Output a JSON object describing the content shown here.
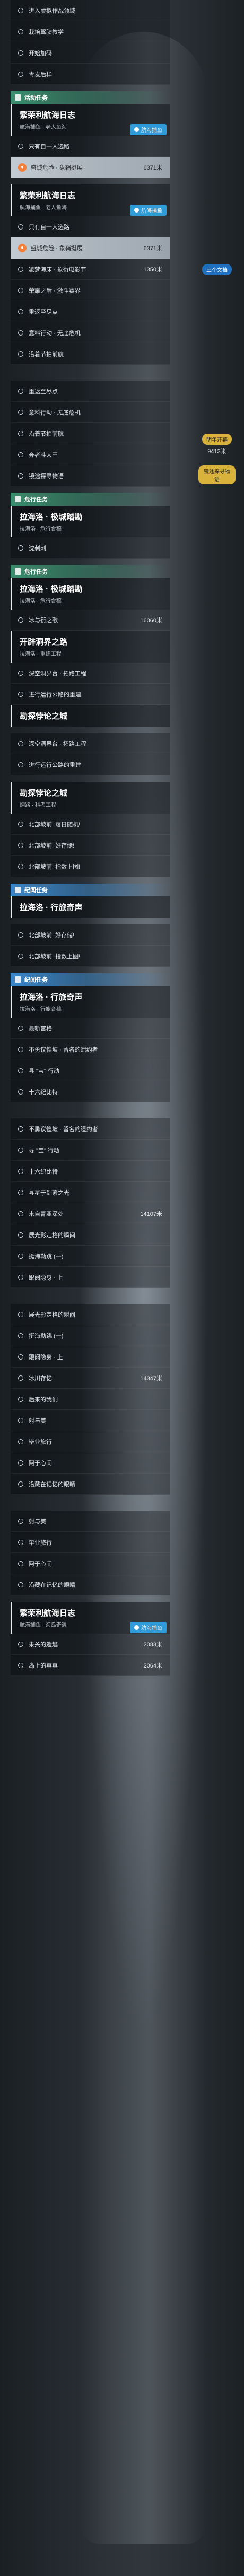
{
  "sec1": {
    "rows": [
      {
        "label": "进入虚拟作战领域!",
        "dist": ""
      },
      {
        "label": "栽培驾驶教学",
        "dist": ""
      },
      {
        "label": "开始加码",
        "dist": ""
      },
      {
        "label": "青发后样",
        "dist": ""
      }
    ]
  },
  "sec2": {
    "header": "活动任务",
    "card": {
      "title": "繁荣利航海日志",
      "sub": "航海捕鱼 · 老人鱼海",
      "badge": "航海捕鱼"
    },
    "rows": [
      {
        "label": "只有自一人选路",
        "dist": ""
      },
      {
        "label": "盛城危险 · 象鞘挺展",
        "dist": "6371米",
        "active": true
      }
    ]
  },
  "sec3": {
    "card": {
      "title": "繁荣利航海日志",
      "sub": "航海捕鱼 · 老人鱼海",
      "badge": "航海捕鱼"
    },
    "rows": [
      {
        "label": "只有自一人选路",
        "dist": ""
      },
      {
        "label": "盛城危险 · 象鞘挺展",
        "dist": "6371米",
        "active": true
      },
      {
        "label": "凌梦海床 · 象衍电影节",
        "dist": "1350米"
      },
      {
        "label": "荣耀之后 · 激斗赛界",
        "dist": ""
      },
      {
        "label": "重返至尽点",
        "dist": ""
      },
      {
        "label": "意料行动 · 无底危机",
        "dist": ""
      },
      {
        "label": "沿着节拍前航",
        "dist": ""
      }
    ],
    "side1": {
      "pill": "三个文档",
      "num": "1350米"
    }
  },
  "sec4": {
    "rows": [
      {
        "label": "重返至尽点",
        "dist": ""
      },
      {
        "label": "意料行动 · 无底危机",
        "dist": ""
      },
      {
        "label": "沿着节拍前航",
        "dist": ""
      },
      {
        "label": "奔者斗大王",
        "dist": ""
      },
      {
        "label": "镜途探寻物语",
        "dist": ""
      }
    ],
    "side2": {
      "pill": "明年开幕",
      "num": "9413米"
    },
    "side3": {
      "pill": "镜途探寻物语"
    }
  },
  "sec5": {
    "header": "危行任务",
    "card": {
      "title": "拉海洛 · 极城踏勘",
      "sub": "拉海洛 · 危行合稿"
    },
    "rows": [
      {
        "label": "沈刺刺",
        "dist": ""
      }
    ]
  },
  "sec6": {
    "header": "危行任务",
    "card": {
      "title": "拉海洛 · 极城踏勘",
      "sub": "拉海洛 · 危行合稿"
    },
    "rows": [
      {
        "label": "冰与衍之歌",
        "dist": "16060米"
      }
    ],
    "card2": {
      "title": "开辟洞界之路",
      "sub": "拉海洛 · 重建工程"
    },
    "rows2": [
      {
        "label": "深空洞界台 · 拓路工程",
        "dist": ""
      },
      {
        "label": "进行运行公路的重建",
        "dist": ""
      }
    ],
    "card3": {
      "title": "勘探悖论之城",
      "sub": ""
    },
    "rows3": [
      {
        "label": "深空洞界台 · 拓路工程",
        "dist": ""
      },
      {
        "label": "进行运行公路的重建",
        "dist": ""
      }
    ],
    "card4": {
      "title": "勘探悖论之城",
      "sub": "翻路 · 科考工程"
    },
    "rows4": [
      {
        "label": "北部坡前! 落日随机!",
        "dist": ""
      },
      {
        "label": "北部坡前! 好存储!",
        "dist": ""
      },
      {
        "label": "北部坡前! 指数上图!",
        "dist": ""
      }
    ]
  },
  "sec7": {
    "header": "纪闻任务",
    "card": {
      "title": "拉海洛 · 行旅奇声",
      "sub": ""
    },
    "rows": [
      {
        "label": "北部坡前! 好存储!",
        "dist": ""
      },
      {
        "label": "北部坡前! 指数上图!",
        "dist": ""
      }
    ]
  },
  "sec8": {
    "header": "纪闻任务",
    "card": {
      "title": "拉海洛 · 行旅奇声",
      "sub": "拉海洛 · 行旅合稿"
    },
    "rows": [
      {
        "label": "最新宫格",
        "dist": ""
      },
      {
        "label": "不勇议惶坡 · 留名的遗约者",
        "dist": ""
      },
      {
        "label": "寻 \"宝\" 行动",
        "dist": ""
      },
      {
        "label": "十六纪比特",
        "dist": ""
      }
    ]
  },
  "sec9": {
    "rows": [
      {
        "label": "不勇议惶坡 · 留名的遗约者",
        "dist": ""
      },
      {
        "label": "寻 \"宝\" 行动",
        "dist": ""
      },
      {
        "label": "十六纪比特",
        "dist": ""
      },
      {
        "label": "寻星于到繁之光",
        "dist": ""
      },
      {
        "label": "来自青亚深处",
        "dist": "14107米"
      },
      {
        "label": "展光影定格的瞬间",
        "dist": ""
      },
      {
        "label": "挺海勒跳 (一)",
        "dist": ""
      },
      {
        "label": "跟阅隐身 · 上",
        "dist": ""
      }
    ]
  },
  "sec10": {
    "rows": [
      {
        "label": "展光影定格的瞬间",
        "dist": ""
      },
      {
        "label": "挺海勒跳 (一)",
        "dist": ""
      },
      {
        "label": "跟阅隐身 · 上",
        "dist": ""
      },
      {
        "label": "冰川存忆",
        "dist": "14347米"
      },
      {
        "label": "后来的我们",
        "dist": ""
      },
      {
        "label": "射与美",
        "dist": ""
      },
      {
        "label": "毕业旅行",
        "dist": ""
      },
      {
        "label": "阿于心间",
        "dist": ""
      },
      {
        "label": "沿藏在记忆的眼睛",
        "dist": ""
      }
    ]
  },
  "sec11": {
    "rows": [
      {
        "label": "射与美",
        "dist": ""
      },
      {
        "label": "毕业旅行",
        "dist": ""
      },
      {
        "label": "阿于心间",
        "dist": ""
      },
      {
        "label": "沿藏在记忆的眼睛",
        "dist": ""
      }
    ],
    "card": {
      "title": "繁荣利航海日志",
      "sub": "航海捕鱼 · 海岛奇遇",
      "badge": "航海捕鱼"
    },
    "rows2": [
      {
        "label": "未关的遗趣",
        "dist": "2083米"
      },
      {
        "label": "岛上的真真",
        "dist": "2064米"
      }
    ]
  }
}
